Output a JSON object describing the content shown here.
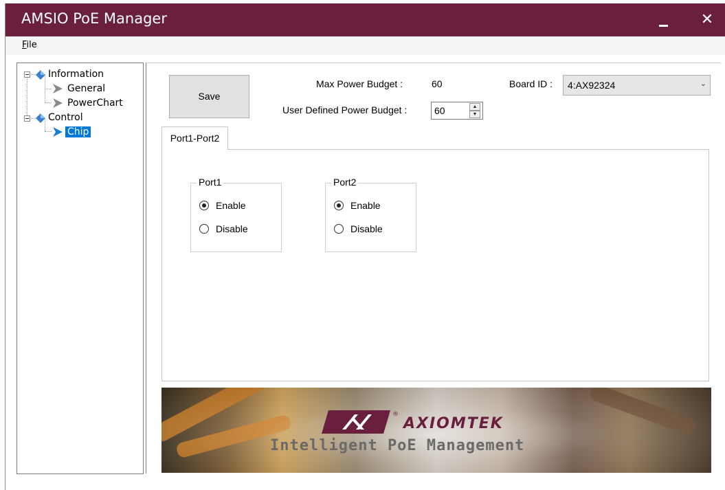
{
  "window": {
    "title": "AMSIO PoE Manager"
  },
  "menu": {
    "file_accel": "F",
    "file_rest": "ile"
  },
  "tree": {
    "information": "Information",
    "general": "General",
    "powerchart": "PowerChart",
    "control": "Control",
    "chip": "Chip"
  },
  "controls": {
    "save_label": "Save",
    "max_power_label": "Max Power Budget :",
    "max_power_value": "60",
    "user_power_label": "User Defined Power Budget :",
    "user_power_value": "60",
    "board_id_label": "Board ID :",
    "board_id_value": "4:AX92324"
  },
  "tabs": [
    {
      "label": "Port1-Port2",
      "selected": true
    }
  ],
  "ports": [
    {
      "title": "Port1",
      "enable": "Enable",
      "disable": "Disable",
      "selected": "Enable"
    },
    {
      "title": "Port2",
      "enable": "Enable",
      "disable": "Disable",
      "selected": "Enable"
    }
  ],
  "banner": {
    "brand": "AXIOMTEK",
    "registered": "®",
    "tagline": "Intelligent PoE Management"
  },
  "colors": {
    "titlebar": "#6b1f3f",
    "selection": "#0078d7",
    "brand": "#6b1f3f"
  }
}
